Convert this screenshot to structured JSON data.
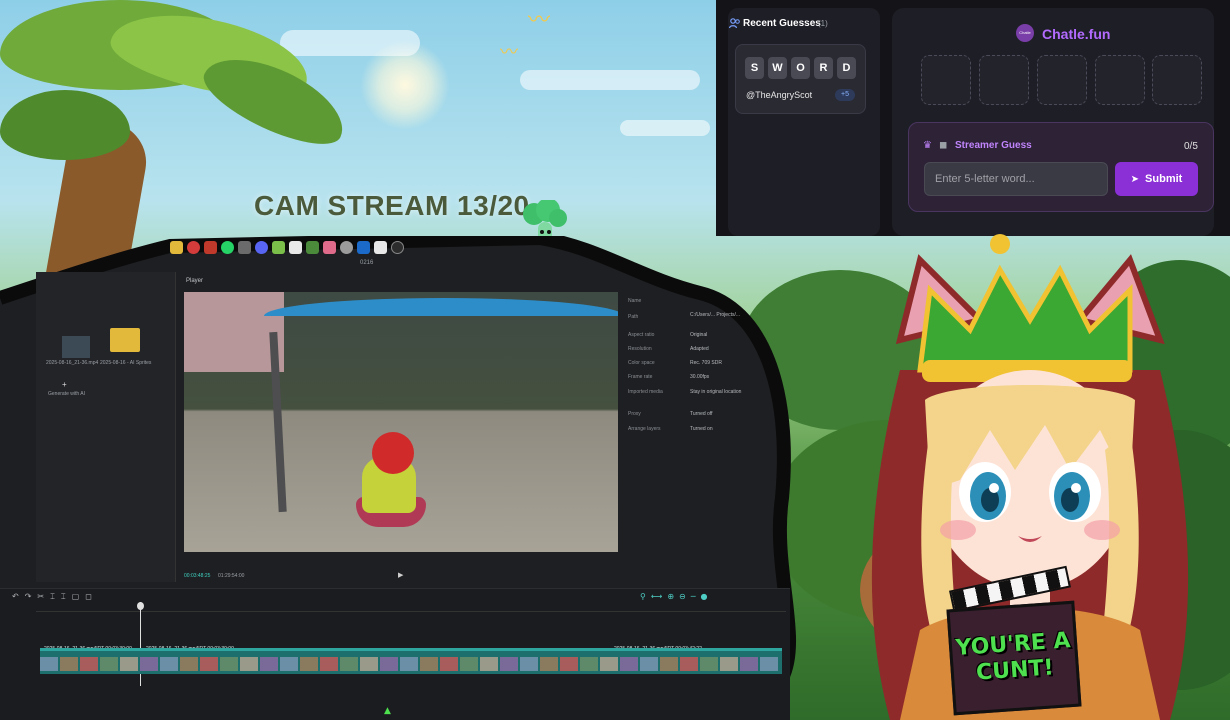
{
  "stream": {
    "title": "CAM STREAM 13/20"
  },
  "editor": {
    "window_title": "0216",
    "player_label": "Player",
    "time_current": "00:03:48:25",
    "time_total": "01:29:54:00",
    "media": {
      "thumb_label": "2025-08-16_21-36.mp4",
      "folder_label": "2025-08-16 - AI Sprites",
      "generate_label": "Generate with AI"
    },
    "properties": [
      {
        "label": "Name",
        "value": ""
      },
      {
        "label": "Path",
        "value": "C:/Users/... Projects/..."
      },
      {
        "label": "Aspect ratio",
        "value": "Original"
      },
      {
        "label": "Resolution",
        "value": "Adapted"
      },
      {
        "label": "Color space",
        "value": "Rec. 709 SDR"
      },
      {
        "label": "Frame rate",
        "value": "30.00fps"
      },
      {
        "label": "Imported media",
        "value": "Stay in original location"
      },
      {
        "label": "Proxy",
        "value": "Turned off"
      },
      {
        "label": "Arrange layers",
        "value": "Turned on"
      }
    ],
    "timeline": {
      "clip_label_1": "2025-08-16_21-36.mp4|RT  00:03:30:00",
      "clip_label_2": "2025-08-16_21-36.mp4|RT  00:03:30:00",
      "clip_label_3": "2025-08-16_21-36.mp4|RT  00:03:42:22"
    }
  },
  "chatle": {
    "brand": "Chatle.fun",
    "logo_text": "Chatle",
    "recent": {
      "title": "Recent Guesses",
      "count": "(1)",
      "guesses": [
        {
          "letters": [
            "S",
            "W",
            "O",
            "R",
            "D"
          ],
          "user": "@TheAngryScot",
          "badge": "+5"
        }
      ]
    },
    "streamer": {
      "title": "Streamer Guess",
      "count": "0/5",
      "input_placeholder": "Enter 5-letter word...",
      "input_value": "",
      "submit_label": "Submit"
    }
  },
  "avatar": {
    "sign_text": "YOU'RE A CUNT!"
  },
  "colors": {
    "accent": "#b36bff",
    "submit": "#8b2fd6",
    "timeline_clip": "#1c6f6c",
    "sign_text": "#4ee04e"
  }
}
